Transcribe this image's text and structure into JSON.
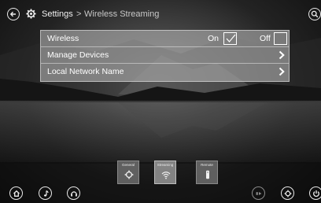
{
  "header": {
    "crumb_settings": "Settings",
    "crumb_separator": ">",
    "crumb_page": "Wireless Streaming",
    "icons": {
      "back": "back-arrow-icon",
      "gear": "gear-icon",
      "search": "search-icon"
    }
  },
  "settings": {
    "wireless": {
      "label": "Wireless",
      "on_label": "On",
      "off_label": "Off",
      "selected": "On"
    },
    "manage_devices": {
      "label": "Manage Devices"
    },
    "network_name": {
      "label": "Local Network Name"
    }
  },
  "categories": [
    {
      "label": "General",
      "icon": "gear-icon",
      "active": false
    },
    {
      "label": "Streaming",
      "icon": "wifi-icon",
      "active": true
    },
    {
      "label": "Remote",
      "icon": "remote-icon",
      "active": false
    }
  ],
  "bottom_bar": {
    "icons": [
      "home-icon",
      "music-note-icon",
      "headphones-icon",
      "next-icon",
      "settings-icon",
      "power-icon"
    ]
  },
  "colors": {
    "panel_bg": "#afafaf",
    "text": "#ffffff",
    "accent_dim": "#c8c8c8"
  }
}
